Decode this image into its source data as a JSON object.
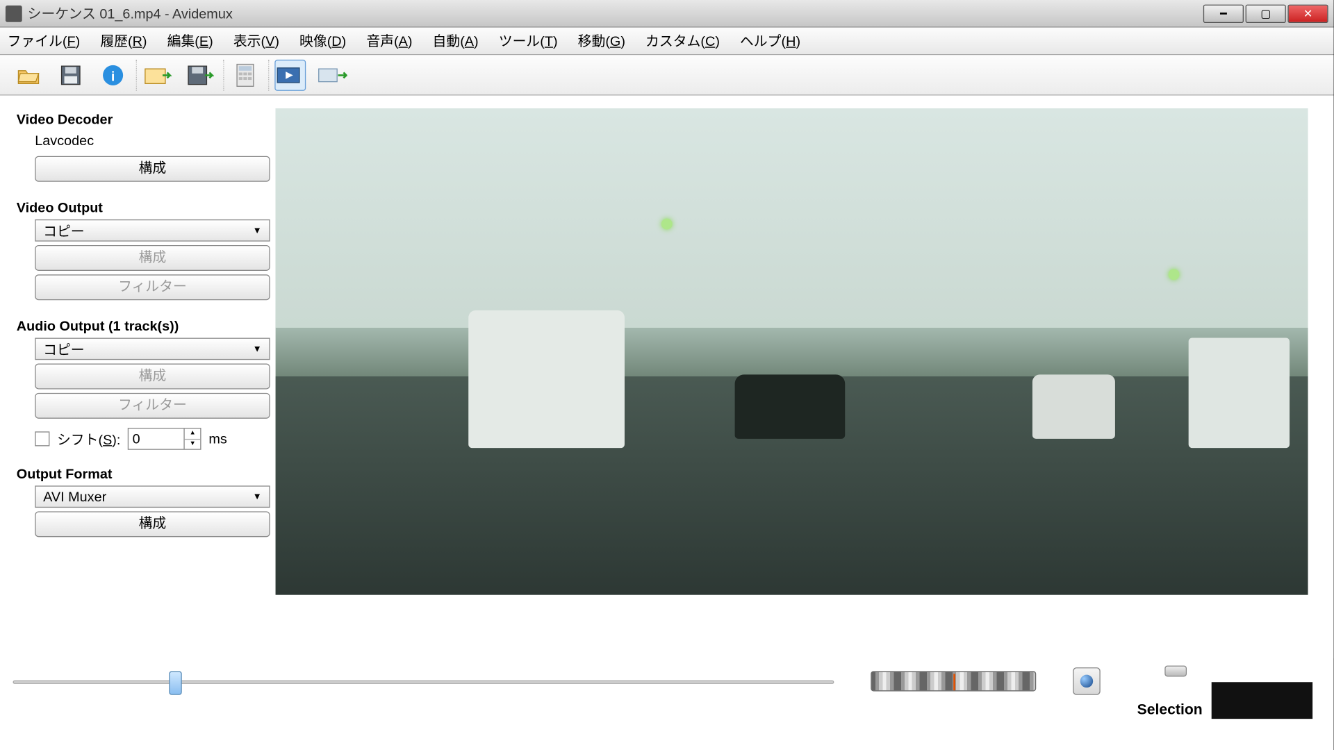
{
  "window": {
    "title": "シーケンス 01_6.mp4 - Avidemux"
  },
  "menu": {
    "file": {
      "label": "ファイル(",
      "key": "F",
      "suffix": ")"
    },
    "history": {
      "label": "履歴(",
      "key": "R",
      "suffix": ")"
    },
    "edit": {
      "label": "編集(",
      "key": "E",
      "suffix": ")"
    },
    "view": {
      "label": "表示(",
      "key": "V",
      "suffix": ")"
    },
    "video": {
      "label": "映像(",
      "key": "D",
      "suffix": ")"
    },
    "audio": {
      "label": "音声(",
      "key": "A",
      "suffix": ")"
    },
    "auto": {
      "label": "自動(",
      "key": "A",
      "suffix": ")"
    },
    "tools": {
      "label": "ツール(",
      "key": "T",
      "suffix": ")"
    },
    "go": {
      "label": "移動(",
      "key": "G",
      "suffix": ")"
    },
    "custom": {
      "label": "カスタム(",
      "key": "C",
      "suffix": ")"
    },
    "help": {
      "label": "ヘルプ(",
      "key": "H",
      "suffix": ")"
    }
  },
  "sidebar": {
    "decoder_head": "Video Decoder",
    "decoder_name": "Lavcodec",
    "decoder_config_btn": "構成",
    "video_out_head": "Video Output",
    "video_out_select": "コピー",
    "video_out_config_btn": "構成",
    "video_out_filter_btn": "フィルター",
    "audio_out_head": "Audio Output  (1 track(s))",
    "audio_out_select": "コピー",
    "audio_out_config_btn": "構成",
    "audio_out_filter_btn": "フィルター",
    "shift_label_pre": "シフト(",
    "shift_key": "S",
    "shift_label_post": "):",
    "shift_value": "0",
    "shift_unit": "ms",
    "format_head": "Output Format",
    "format_select": "AVI Muxer",
    "format_config_btn": "構成"
  },
  "bottom": {
    "selection_label": "Selection"
  }
}
